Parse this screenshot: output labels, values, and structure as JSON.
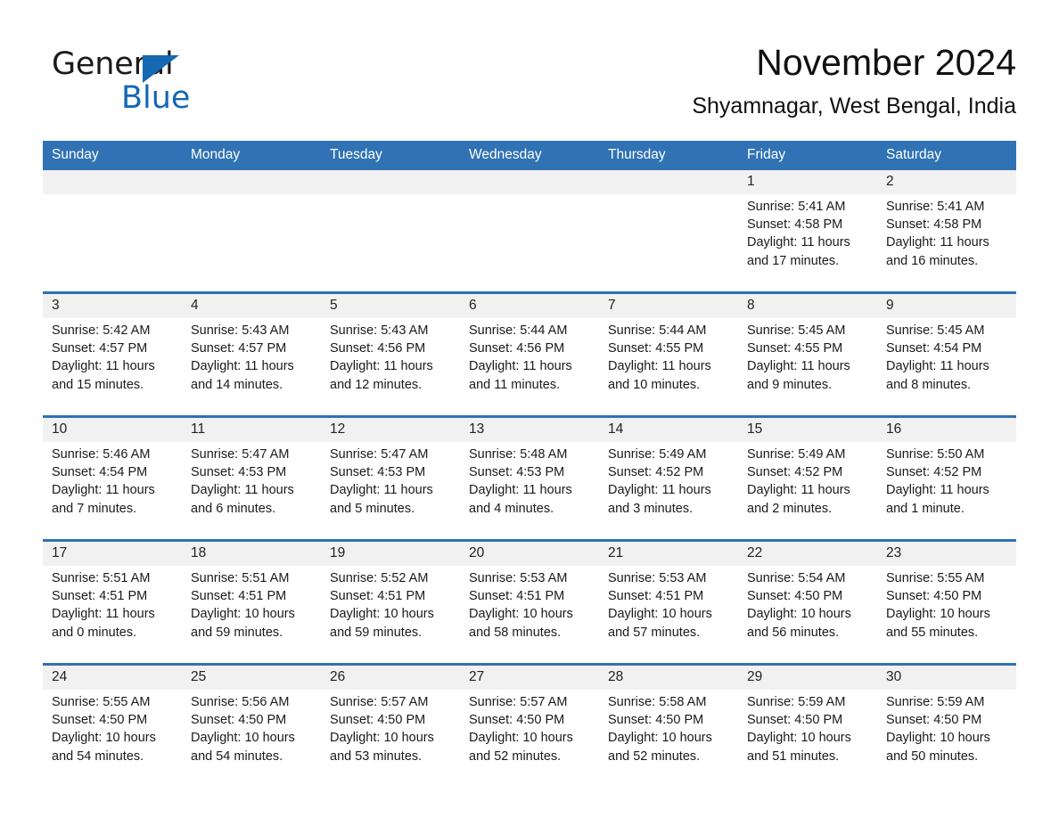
{
  "brand": {
    "word_one": "General",
    "word_two": "Blue",
    "triangle_color": "#1668b3"
  },
  "header": {
    "month_title": "November 2024",
    "location": "Shyamnagar, West Bengal, India"
  },
  "colors": {
    "header_blue": "#3072b3",
    "date_band_gray": "#f1f1f1",
    "week_separator": "#3072b3",
    "text": "#1a1a1a"
  },
  "weekday_headers": [
    "Sunday",
    "Monday",
    "Tuesday",
    "Wednesday",
    "Thursday",
    "Friday",
    "Saturday"
  ],
  "weeks": [
    {
      "days": [
        {
          "date": "",
          "lines": []
        },
        {
          "date": "",
          "lines": []
        },
        {
          "date": "",
          "lines": []
        },
        {
          "date": "",
          "lines": []
        },
        {
          "date": "",
          "lines": []
        },
        {
          "date": "1",
          "lines": [
            "Sunrise: 5:41 AM",
            "Sunset: 4:58 PM",
            "Daylight: 11 hours",
            "and 17 minutes."
          ]
        },
        {
          "date": "2",
          "lines": [
            "Sunrise: 5:41 AM",
            "Sunset: 4:58 PM",
            "Daylight: 11 hours",
            "and 16 minutes."
          ]
        }
      ]
    },
    {
      "days": [
        {
          "date": "3",
          "lines": [
            "Sunrise: 5:42 AM",
            "Sunset: 4:57 PM",
            "Daylight: 11 hours",
            "and 15 minutes."
          ]
        },
        {
          "date": "4",
          "lines": [
            "Sunrise: 5:43 AM",
            "Sunset: 4:57 PM",
            "Daylight: 11 hours",
            "and 14 minutes."
          ]
        },
        {
          "date": "5",
          "lines": [
            "Sunrise: 5:43 AM",
            "Sunset: 4:56 PM",
            "Daylight: 11 hours",
            "and 12 minutes."
          ]
        },
        {
          "date": "6",
          "lines": [
            "Sunrise: 5:44 AM",
            "Sunset: 4:56 PM",
            "Daylight: 11 hours",
            "and 11 minutes."
          ]
        },
        {
          "date": "7",
          "lines": [
            "Sunrise: 5:44 AM",
            "Sunset: 4:55 PM",
            "Daylight: 11 hours",
            "and 10 minutes."
          ]
        },
        {
          "date": "8",
          "lines": [
            "Sunrise: 5:45 AM",
            "Sunset: 4:55 PM",
            "Daylight: 11 hours",
            "and 9 minutes."
          ]
        },
        {
          "date": "9",
          "lines": [
            "Sunrise: 5:45 AM",
            "Sunset: 4:54 PM",
            "Daylight: 11 hours",
            "and 8 minutes."
          ]
        }
      ]
    },
    {
      "days": [
        {
          "date": "10",
          "lines": [
            "Sunrise: 5:46 AM",
            "Sunset: 4:54 PM",
            "Daylight: 11 hours",
            "and 7 minutes."
          ]
        },
        {
          "date": "11",
          "lines": [
            "Sunrise: 5:47 AM",
            "Sunset: 4:53 PM",
            "Daylight: 11 hours",
            "and 6 minutes."
          ]
        },
        {
          "date": "12",
          "lines": [
            "Sunrise: 5:47 AM",
            "Sunset: 4:53 PM",
            "Daylight: 11 hours",
            "and 5 minutes."
          ]
        },
        {
          "date": "13",
          "lines": [
            "Sunrise: 5:48 AM",
            "Sunset: 4:53 PM",
            "Daylight: 11 hours",
            "and 4 minutes."
          ]
        },
        {
          "date": "14",
          "lines": [
            "Sunrise: 5:49 AM",
            "Sunset: 4:52 PM",
            "Daylight: 11 hours",
            "and 3 minutes."
          ]
        },
        {
          "date": "15",
          "lines": [
            "Sunrise: 5:49 AM",
            "Sunset: 4:52 PM",
            "Daylight: 11 hours",
            "and 2 minutes."
          ]
        },
        {
          "date": "16",
          "lines": [
            "Sunrise: 5:50 AM",
            "Sunset: 4:52 PM",
            "Daylight: 11 hours",
            "and 1 minute."
          ]
        }
      ]
    },
    {
      "days": [
        {
          "date": "17",
          "lines": [
            "Sunrise: 5:51 AM",
            "Sunset: 4:51 PM",
            "Daylight: 11 hours",
            "and 0 minutes."
          ]
        },
        {
          "date": "18",
          "lines": [
            "Sunrise: 5:51 AM",
            "Sunset: 4:51 PM",
            "Daylight: 10 hours",
            "and 59 minutes."
          ]
        },
        {
          "date": "19",
          "lines": [
            "Sunrise: 5:52 AM",
            "Sunset: 4:51 PM",
            "Daylight: 10 hours",
            "and 59 minutes."
          ]
        },
        {
          "date": "20",
          "lines": [
            "Sunrise: 5:53 AM",
            "Sunset: 4:51 PM",
            "Daylight: 10 hours",
            "and 58 minutes."
          ]
        },
        {
          "date": "21",
          "lines": [
            "Sunrise: 5:53 AM",
            "Sunset: 4:51 PM",
            "Daylight: 10 hours",
            "and 57 minutes."
          ]
        },
        {
          "date": "22",
          "lines": [
            "Sunrise: 5:54 AM",
            "Sunset: 4:50 PM",
            "Daylight: 10 hours",
            "and 56 minutes."
          ]
        },
        {
          "date": "23",
          "lines": [
            "Sunrise: 5:55 AM",
            "Sunset: 4:50 PM",
            "Daylight: 10 hours",
            "and 55 minutes."
          ]
        }
      ]
    },
    {
      "days": [
        {
          "date": "24",
          "lines": [
            "Sunrise: 5:55 AM",
            "Sunset: 4:50 PM",
            "Daylight: 10 hours",
            "and 54 minutes."
          ]
        },
        {
          "date": "25",
          "lines": [
            "Sunrise: 5:56 AM",
            "Sunset: 4:50 PM",
            "Daylight: 10 hours",
            "and 54 minutes."
          ]
        },
        {
          "date": "26",
          "lines": [
            "Sunrise: 5:57 AM",
            "Sunset: 4:50 PM",
            "Daylight: 10 hours",
            "and 53 minutes."
          ]
        },
        {
          "date": "27",
          "lines": [
            "Sunrise: 5:57 AM",
            "Sunset: 4:50 PM",
            "Daylight: 10 hours",
            "and 52 minutes."
          ]
        },
        {
          "date": "28",
          "lines": [
            "Sunrise: 5:58 AM",
            "Sunset: 4:50 PM",
            "Daylight: 10 hours",
            "and 52 minutes."
          ]
        },
        {
          "date": "29",
          "lines": [
            "Sunrise: 5:59 AM",
            "Sunset: 4:50 PM",
            "Daylight: 10 hours",
            "and 51 minutes."
          ]
        },
        {
          "date": "30",
          "lines": [
            "Sunrise: 5:59 AM",
            "Sunset: 4:50 PM",
            "Daylight: 10 hours",
            "and 50 minutes."
          ]
        }
      ]
    }
  ]
}
